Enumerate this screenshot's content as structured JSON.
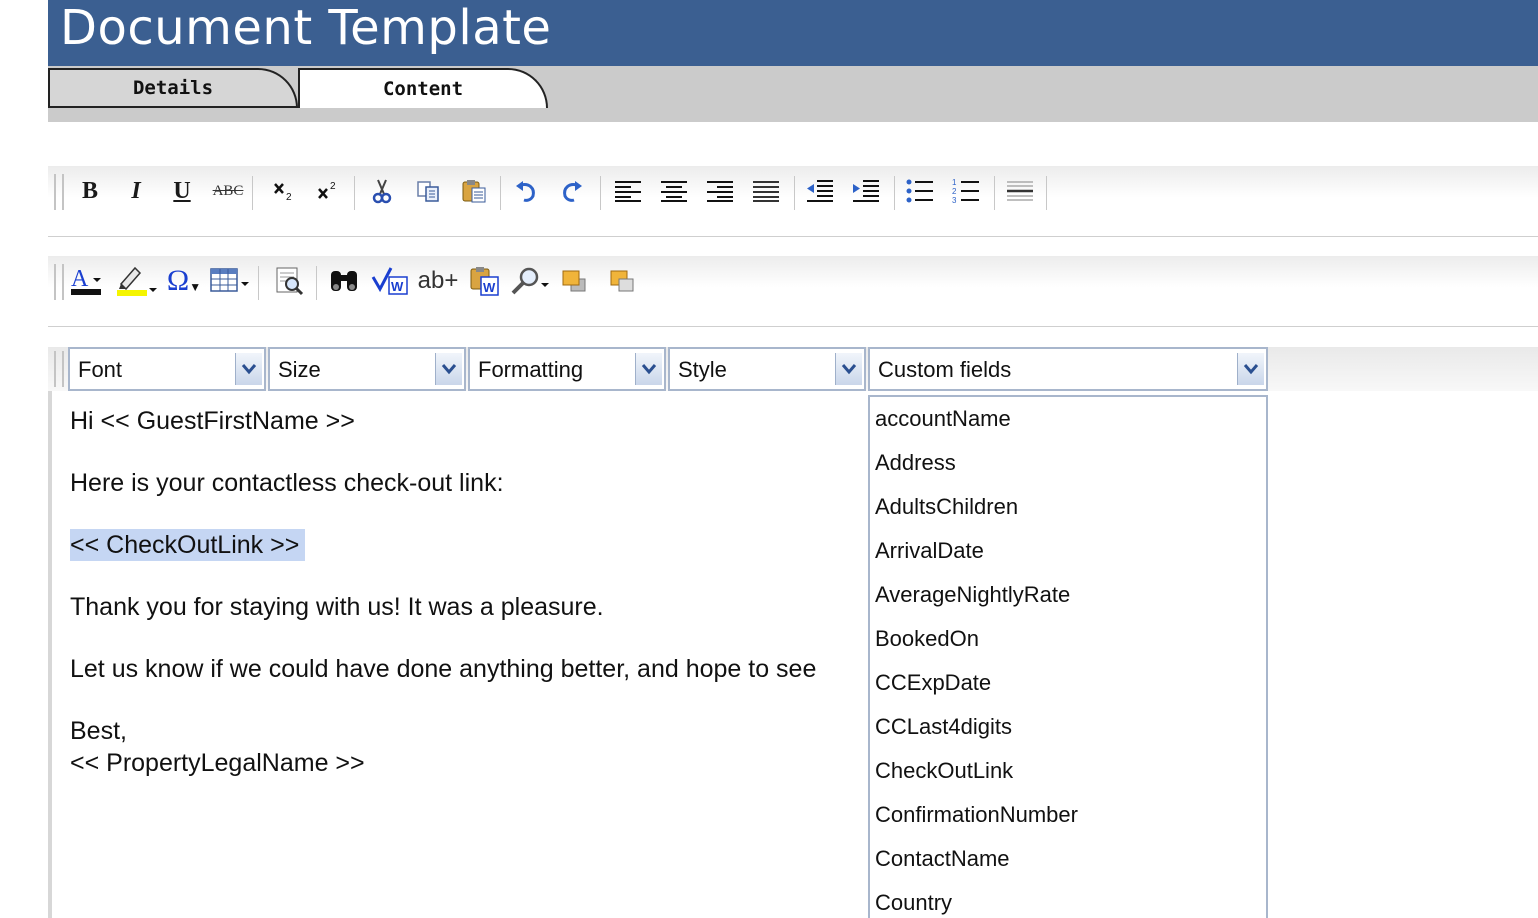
{
  "page": {
    "title": "Document Template"
  },
  "tabs": [
    {
      "label": "Details"
    },
    {
      "label": "Content"
    }
  ],
  "toolbar1": {
    "icons": [
      "bold-icon",
      "italic-icon",
      "underline-icon",
      "strikethrough-icon",
      "subscript-icon",
      "superscript-icon",
      "cut-icon",
      "copy-icon",
      "paste-icon",
      "undo-icon",
      "redo-icon",
      "align-left-icon",
      "align-center-icon",
      "align-right-icon",
      "justify-icon",
      "outdent-icon",
      "indent-icon",
      "bullet-list-icon",
      "numbered-list-icon",
      "horizontal-rule-icon"
    ],
    "bold_glyph": "B",
    "italic_glyph": "I",
    "underline_glyph": "U",
    "strike_glyph": "ABC"
  },
  "toolbar2": {
    "icons": [
      "font-color-icon",
      "highlight-color-icon",
      "special-character-icon",
      "table-icon",
      "preview-icon",
      "find-icon",
      "spellcheck-icon",
      "insert-field-icon",
      "paste-from-word-icon",
      "zoom-icon",
      "bring-forward-icon",
      "send-backward-icon"
    ],
    "omega_glyph": "Ω",
    "abplus_glyph": "ab+",
    "font_color": "#1a3fd0",
    "highlight_color": "#f5f500"
  },
  "dropdowns": {
    "font": "Font",
    "size": "Size",
    "formatting": "Formatting",
    "style": "Style",
    "custom_fields": "Custom fields"
  },
  "editor": {
    "line1": "Hi << GuestFirstName >>",
    "line2": "Here is your contactless check-out link:",
    "line3": "<< CheckOutLink >>",
    "line4": "Thank you for staying with us! It was a pleasure.",
    "line5": "Let us know if we could have done anything better, and hope to see",
    "line6": "Best,",
    "line7": "<< PropertyLegalName >>"
  },
  "custom_fields": [
    "accountName",
    "Address",
    "AdultsChildren",
    "ArrivalDate",
    "AverageNightlyRate",
    "BookedOn",
    "CCExpDate",
    "CCLast4digits",
    "CheckOutLink",
    "ConfirmationNumber",
    "ContactName",
    "Country"
  ]
}
